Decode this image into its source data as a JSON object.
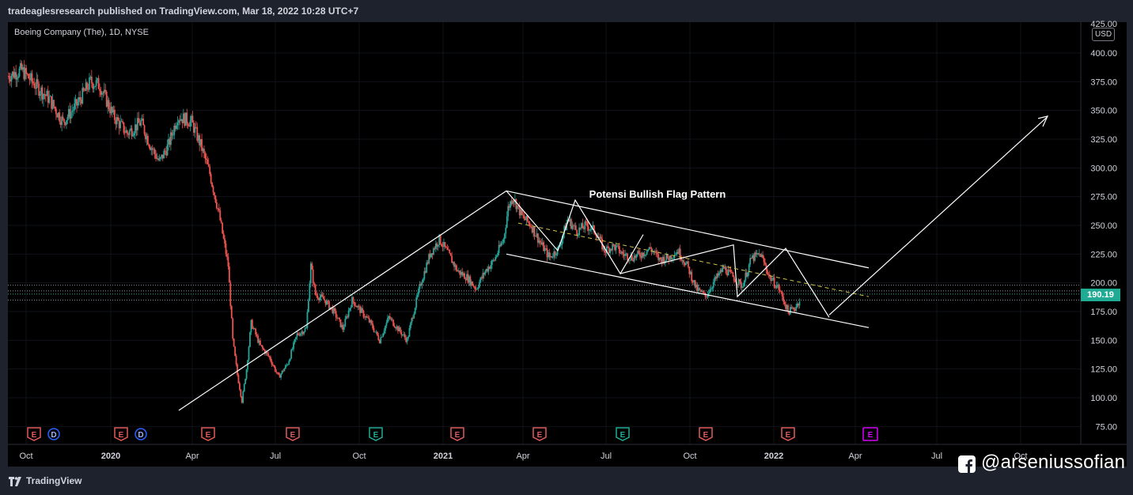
{
  "header": {
    "published_text": "tradeaglesresearch published on TradingView.com, Mar 18, 2022 10:28 UTC+7"
  },
  "symbol_info": "Boeing Company (The), 1D, NYSE",
  "currency": "USD",
  "footer": {
    "brand": "TradingView"
  },
  "watermark": {
    "text": "@arseniussofian",
    "icon": "facebook-icon"
  },
  "colors": {
    "up": "#26a69a",
    "down": "#ef5350",
    "price_tag": "#22ab94",
    "drawing": "#ffffff",
    "midline": "#d4c24a",
    "earnings_red": "#e05a5a",
    "earnings_green": "#22ab94",
    "dividend": "#2962ff",
    "earnings_next": "#d500f9"
  },
  "chart_data": {
    "type": "candlestick",
    "title": "",
    "price_axis": {
      "ticks": [
        75,
        100,
        125,
        150,
        175,
        200,
        225,
        250,
        275,
        300,
        325,
        350,
        375,
        400
      ],
      "labels": [
        "75.00",
        "100.00",
        "125.00",
        "150.00",
        "175.00",
        "200.00",
        "225.00",
        "250.00",
        "275.00",
        "300.00",
        "325.00",
        "350.00",
        "375.00",
        "400.00"
      ],
      "top_partial_label": "425.00",
      "ylim": [
        65,
        427
      ]
    },
    "time_axis": {
      "labels": [
        "Oct",
        "2020",
        "Apr",
        "Jul",
        "Oct",
        "2021",
        "Apr",
        "Jul",
        "Oct",
        "2022",
        "Apr",
        "Jul",
        "Oct"
      ],
      "bold": [
        "2020",
        "2021",
        "2022"
      ]
    },
    "last_price": {
      "value": 190.19,
      "label": "190.19"
    },
    "price_path": [
      [
        0,
        380
      ],
      [
        6,
        385
      ],
      [
        12,
        372
      ],
      [
        18,
        360
      ],
      [
        24,
        340
      ],
      [
        30,
        355
      ],
      [
        36,
        375
      ],
      [
        40,
        372
      ],
      [
        46,
        345
      ],
      [
        52,
        330
      ],
      [
        58,
        340
      ],
      [
        62,
        320
      ],
      [
        66,
        305
      ],
      [
        70,
        320
      ],
      [
        74,
        345
      ],
      [
        80,
        340
      ],
      [
        84,
        320
      ],
      [
        88,
        295
      ],
      [
        92,
        260
      ],
      [
        96,
        215
      ],
      [
        98,
        150
      ],
      [
        100,
        120
      ],
      [
        102,
        97
      ],
      [
        104,
        125
      ],
      [
        106,
        165
      ],
      [
        110,
        145
      ],
      [
        114,
        135
      ],
      [
        118,
        118
      ],
      [
        122,
        130
      ],
      [
        126,
        155
      ],
      [
        130,
        160
      ],
      [
        132,
        215
      ],
      [
        134,
        190
      ],
      [
        138,
        185
      ],
      [
        142,
        175
      ],
      [
        146,
        160
      ],
      [
        150,
        185
      ],
      [
        154,
        175
      ],
      [
        158,
        165
      ],
      [
        162,
        150
      ],
      [
        166,
        170
      ],
      [
        170,
        160
      ],
      [
        174,
        150
      ],
      [
        176,
        168
      ],
      [
        180,
        200
      ],
      [
        184,
        225
      ],
      [
        188,
        238
      ],
      [
        192,
        225
      ],
      [
        196,
        210
      ],
      [
        200,
        205
      ],
      [
        204,
        195
      ],
      [
        208,
        210
      ],
      [
        212,
        220
      ],
      [
        216,
        238
      ],
      [
        218,
        265
      ],
      [
        220,
        275
      ],
      [
        224,
        258
      ],
      [
        228,
        250
      ],
      [
        232,
        235
      ],
      [
        236,
        222
      ],
      [
        240,
        230
      ],
      [
        244,
        255
      ],
      [
        248,
        245
      ],
      [
        252,
        250
      ],
      [
        256,
        245
      ],
      [
        260,
        228
      ],
      [
        264,
        232
      ],
      [
        268,
        225
      ],
      [
        272,
        222
      ],
      [
        276,
        225
      ],
      [
        280,
        230
      ],
      [
        284,
        220
      ],
      [
        288,
        222
      ],
      [
        292,
        228
      ],
      [
        296,
        215
      ],
      [
        300,
        195
      ],
      [
        304,
        188
      ],
      [
        308,
        202
      ],
      [
        312,
        213
      ],
      [
        316,
        205
      ],
      [
        320,
        197
      ],
      [
        324,
        221
      ],
      [
        328,
        225
      ],
      [
        332,
        205
      ],
      [
        336,
        195
      ],
      [
        340,
        175
      ],
      [
        343,
        178
      ],
      [
        345,
        185
      ]
    ],
    "annotations": [
      {
        "text": "Potensi Bullish Flag Pattern"
      }
    ],
    "drawings": {
      "flagpole": [
        [
          -9,
          89
        ],
        [
          35.2,
          280
        ]
      ],
      "channel_upper": [
        [
          35.2,
          280
        ],
        [
          72.5,
          213
        ]
      ],
      "channel_lower": [
        [
          35.2,
          225
        ],
        [
          72.5,
          161
        ]
      ],
      "channel_mid": [
        [
          37.2,
          250
        ],
        [
          72.5,
          188
        ]
      ],
      "zigzag": [
        [
          35.2,
          280
        ],
        [
          42,
          215
        ],
        [
          46,
          262
        ],
        [
          52,
          208
        ],
        [
          61,
          234
        ],
        [
          64,
          190
        ],
        [
          69,
          230
        ],
        [
          73,
          172
        ],
        [
          76,
          205
        ],
        [
          80,
          178
        ],
        [
          84,
          201
        ],
        [
          88,
          180
        ],
        [
          92,
          186
        ],
        [
          96,
          212
        ],
        [
          104,
          202
        ],
        [
          112,
          200
        ],
        [
          120,
          197
        ],
        [
          128,
          230
        ],
        [
          136,
          227
        ],
        [
          142,
          170
        ],
        [
          146,
          178
        ],
        [
          148,
          190
        ],
        [
          152,
          214
        ]
      ],
      "breakout_arrow": [
        [
          72,
          172
        ],
        [
          96,
          345
        ]
      ],
      "horizontal_levels": [
        198,
        193,
        185
      ]
    },
    "events": [
      {
        "x": 43,
        "label": "E",
        "type": "earnings"
      },
      {
        "x": 68,
        "label": "D",
        "type": "dividend"
      },
      {
        "x": 153,
        "label": "E",
        "type": "earnings"
      },
      {
        "x": 178,
        "label": "D",
        "type": "dividend"
      },
      {
        "x": 263,
        "label": "E",
        "type": "earnings"
      },
      {
        "x": 370,
        "label": "E",
        "type": "earnings"
      },
      {
        "x": 475,
        "label": "E",
        "type": "earnings_beat"
      },
      {
        "x": 578,
        "label": "E",
        "type": "earnings"
      },
      {
        "x": 682,
        "label": "E",
        "type": "earnings"
      },
      {
        "x": 787,
        "label": "E",
        "type": "earnings_beat"
      },
      {
        "x": 892,
        "label": "E",
        "type": "earnings"
      },
      {
        "x": 996,
        "label": "E",
        "type": "earnings"
      },
      {
        "x": 1100,
        "label": "E",
        "type": "earnings_next"
      }
    ]
  }
}
